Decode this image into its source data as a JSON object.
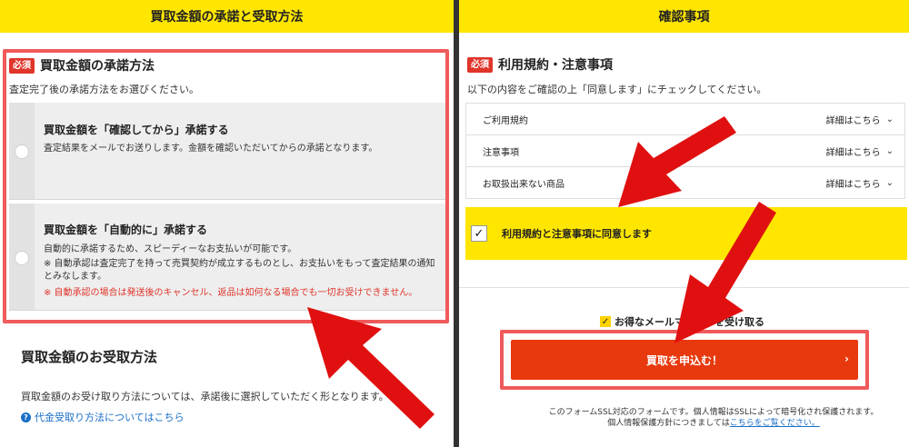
{
  "left": {
    "header": "買取金額の承諾と受取方法",
    "approval": {
      "badge": "必須",
      "title": "買取金額の承諾方法",
      "desc": "査定完了後の承諾方法をお選びください。",
      "options": [
        {
          "title": "買取金額を「確認してから」承諾する",
          "desc": "査定結果をメールでお送りします。金額を確認いただいてからの承諾となります。"
        },
        {
          "title": "買取金額を「自動的に」承諾する",
          "desc": "自動的に承諾するため、スピーディーなお支払いが可能です。",
          "note": "※ 自動承認は査定完了を持って売買契約が成立するものとし、お支払いをもって査定結果の通知とみなします。",
          "warning": "※ 自動承認の場合は発送後のキャンセル、返品は如何なる場合でも一切お受けできません。"
        }
      ]
    },
    "receipt": {
      "title": "買取金額のお受取方法",
      "desc": "買取金額のお受け取り方法については、承諾後に選択していただく形となります。",
      "link": "代金受取り方法についてはこちら",
      "link_icon": "?"
    }
  },
  "right": {
    "header": "確認事項",
    "terms": {
      "badge": "必須",
      "title": "利用規約・注意事項",
      "desc": "以下の内容をご確認の上「同意します」にチェックしてください。",
      "items": [
        {
          "label": "ご利用規約",
          "link": "詳細はこちら"
        },
        {
          "label": "注意事項",
          "link": "詳細はこちら"
        },
        {
          "label": "お取扱出来ない商品",
          "link": "詳細はこちら"
        }
      ],
      "agree_label": "利用規約と注意事項に同意します",
      "agree_checked": true
    },
    "magazine": {
      "label": "お得なメールマガジンを受け取る",
      "checked": true
    },
    "submit_label": "買取を申込む！",
    "ssl_line1": "このフォームSSL対応のフォームです。個人情報はSSLによって暗号化され保護されます。",
    "ssl_line2_prefix": "個人情報保護方針につきましては",
    "ssl_line2_link": "こちらをご覧ください。"
  },
  "colors": {
    "header_yellow": "#ffe600",
    "highlight_red": "#ef5a5a",
    "badge_red": "#e0352b",
    "button_orange": "#e8390e",
    "arrow_red": "#e01010",
    "link_blue": "#1a6fc7"
  },
  "icons": {
    "chevron": "chevron-down-icon",
    "check": "check-icon",
    "submit_arrow": "chevron-right-icon",
    "question": "question-circle-icon"
  }
}
